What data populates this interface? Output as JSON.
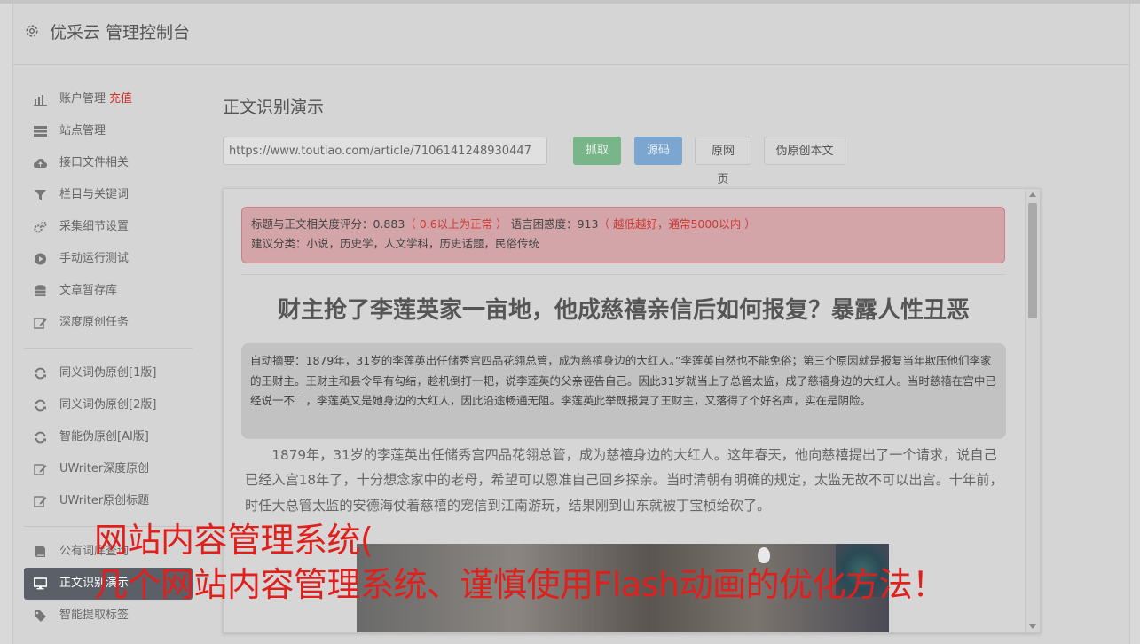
{
  "header": {
    "title": "优采云 管理控制台"
  },
  "sidebar": {
    "recharge_label": "充值",
    "items": [
      {
        "label": "账户管理",
        "icon": "bar-chart-icon"
      },
      {
        "label": "站点管理",
        "icon": "server-icon"
      },
      {
        "label": "接口文件相关",
        "icon": "cloud-upload-icon"
      },
      {
        "label": "栏目与关键词",
        "icon": "filter-icon"
      },
      {
        "label": "采集细节设置",
        "icon": "cogs-icon"
      },
      {
        "label": "手动运行测试",
        "icon": "play-circle-icon"
      },
      {
        "label": "文章暂存库",
        "icon": "database-icon"
      },
      {
        "label": "深度原创任务",
        "icon": "edit-icon"
      },
      {
        "label": "同义词伪原创[1版]",
        "icon": "refresh-icon"
      },
      {
        "label": "同义词伪原创[2版]",
        "icon": "refresh-icon"
      },
      {
        "label": "智能伪原创[AI版]",
        "icon": "refresh-icon"
      },
      {
        "label": "UWriter深度原创",
        "icon": "edit-icon"
      },
      {
        "label": "UWriter原创标题",
        "icon": "edit-icon"
      },
      {
        "label": "公有词库查询",
        "icon": "book-icon"
      },
      {
        "label": "正文识别演示",
        "icon": "desktop-icon"
      },
      {
        "label": "智能提取标签",
        "icon": "tag-icon"
      }
    ]
  },
  "main": {
    "page_title": "正文识别演示",
    "url_value": "https://www.toutiao.com/article/7106141248930447",
    "buttons": {
      "grab": "抓取",
      "source": "源码",
      "original_page": "原网页",
      "rewrite": "伪原创本文"
    },
    "alert": {
      "line1_prefix": "标题与正文相关度评分：0.883",
      "line1_note1": "（ 0.6以上为正常 ）",
      "line1_middle": " 语言困惑度：913",
      "line1_note2": "（ 越低越好，通常5000以内 ）",
      "line2": "建议分类：小说，历史学，人文学科，历史话题，民俗传统"
    },
    "article": {
      "title": "财主抢了李莲英家一亩地，他成慈禧亲信后如何报复？暴露人性丑恶",
      "summary": "自动摘要：1879年，31岁的李莲英出任储秀宫四品花翎总管，成为慈禧身边的大红人。”李莲英自然也不能免俗；第三个原因就是报复当年欺压他们李家的王财主。王财主和县令早有勾结，趁机倒打一耙，说李莲英的父亲诬告自己。因此31岁就当上了总管太监，成了慈禧身边的大红人。当时慈禧在宫中已经说一不二，李莲英又是她身边的大红人，因此沿途畅通无阻。李莲英此举既报复了王财主，又落得了个好名声，实在是阴险。",
      "paragraph": "1879年，31岁的李莲英出任储秀宫四品花翎总管，成为慈禧身边的大红人。这年春天，他向慈禧提出了一个请求，说自己已经入宫18年了，十分想念家中的老母，希望可以恩准自己回乡探亲。当时清朝有明确的规定，太监无故不可以出宫。十年前，时任大总管太监的安德海仗着慈禧的宠信到江南游玩，结果刚到山东就被丁宝桢给砍了。"
    }
  },
  "overlay": {
    "line1": "网站内容管理系统(",
    "line2": "几个网站内容管理系统、谨慎使用Flash动画的优化方法！"
  },
  "colors": {
    "accent_red": "#cc3a34",
    "grab_button": "#78b68a",
    "source_button": "#7ba6cf",
    "active_nav": "#5a5f68",
    "overlay_text": "#e0201c"
  }
}
